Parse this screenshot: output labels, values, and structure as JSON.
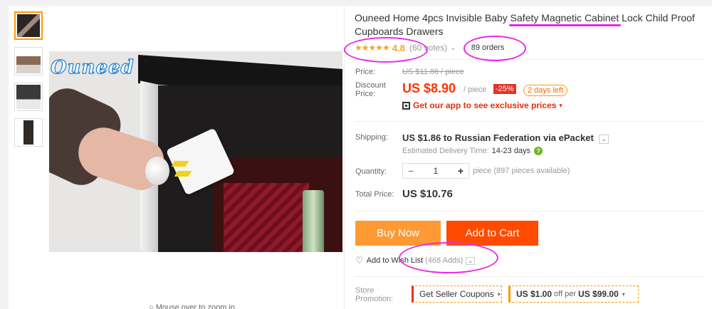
{
  "product": {
    "title": "Ouneed Home 4pcs Invisible Baby Safety Magnetic Cabinet Lock Child Proof Cupboards Drawers",
    "rating": {
      "stars": "★★★★★",
      "score": "4.8",
      "votes": "(60 votes)",
      "votes_chevron": "⌄",
      "orders": "89 orders"
    },
    "image": {
      "logo_text": "Ouneed",
      "zoom_hint": "○ Mouse over to zoom in"
    },
    "thumbnails": [
      "thumb-1",
      "thumb-2",
      "thumb-3",
      "thumb-4"
    ]
  },
  "price": {
    "label": "Price:",
    "original": "US $11.86 / piece",
    "discount_label_1": "Discount",
    "discount_label_2": "Price:",
    "current": "US $8.90",
    "per": "/ piece",
    "discount_badge": "-25%",
    "days_left": "2 days left",
    "app_promo": "Get our app to see exclusive prices",
    "app_promo_chevron": "▾"
  },
  "shipping": {
    "label": "Shipping:",
    "value": "US $1.86 to Russian Federation via ePacket",
    "chevron": "⌄",
    "estimate_label": "Estimated Delivery Time:",
    "estimate_days": "14-23 days",
    "help": "?"
  },
  "quantity": {
    "label": "Quantity:",
    "minus": "−",
    "value": "1",
    "plus": "+",
    "unit": "piece",
    "available": "(897 pieces available)"
  },
  "total": {
    "label": "Total Price:",
    "value": "US $10.76"
  },
  "actions": {
    "buy_now": "Buy Now",
    "add_to_cart": "Add to Cart",
    "wish_list": "Add to Wish List",
    "wish_adds": "(468 Adds)",
    "wish_chevron": "⌄"
  },
  "promotion": {
    "label_1": "Store",
    "label_2": "Promotion:",
    "seller_coupons": "Get Seller Coupons",
    "coupon_amount": "US $1.00",
    "coupon_off_per": "off per",
    "coupon_threshold": "US $99.00",
    "chevron": "▾"
  },
  "colors": {
    "accent_orange": "#ff9933",
    "cart_red": "#ff4a00",
    "price_red": "#ff3300",
    "annotation_pink": "#e62ae6"
  }
}
